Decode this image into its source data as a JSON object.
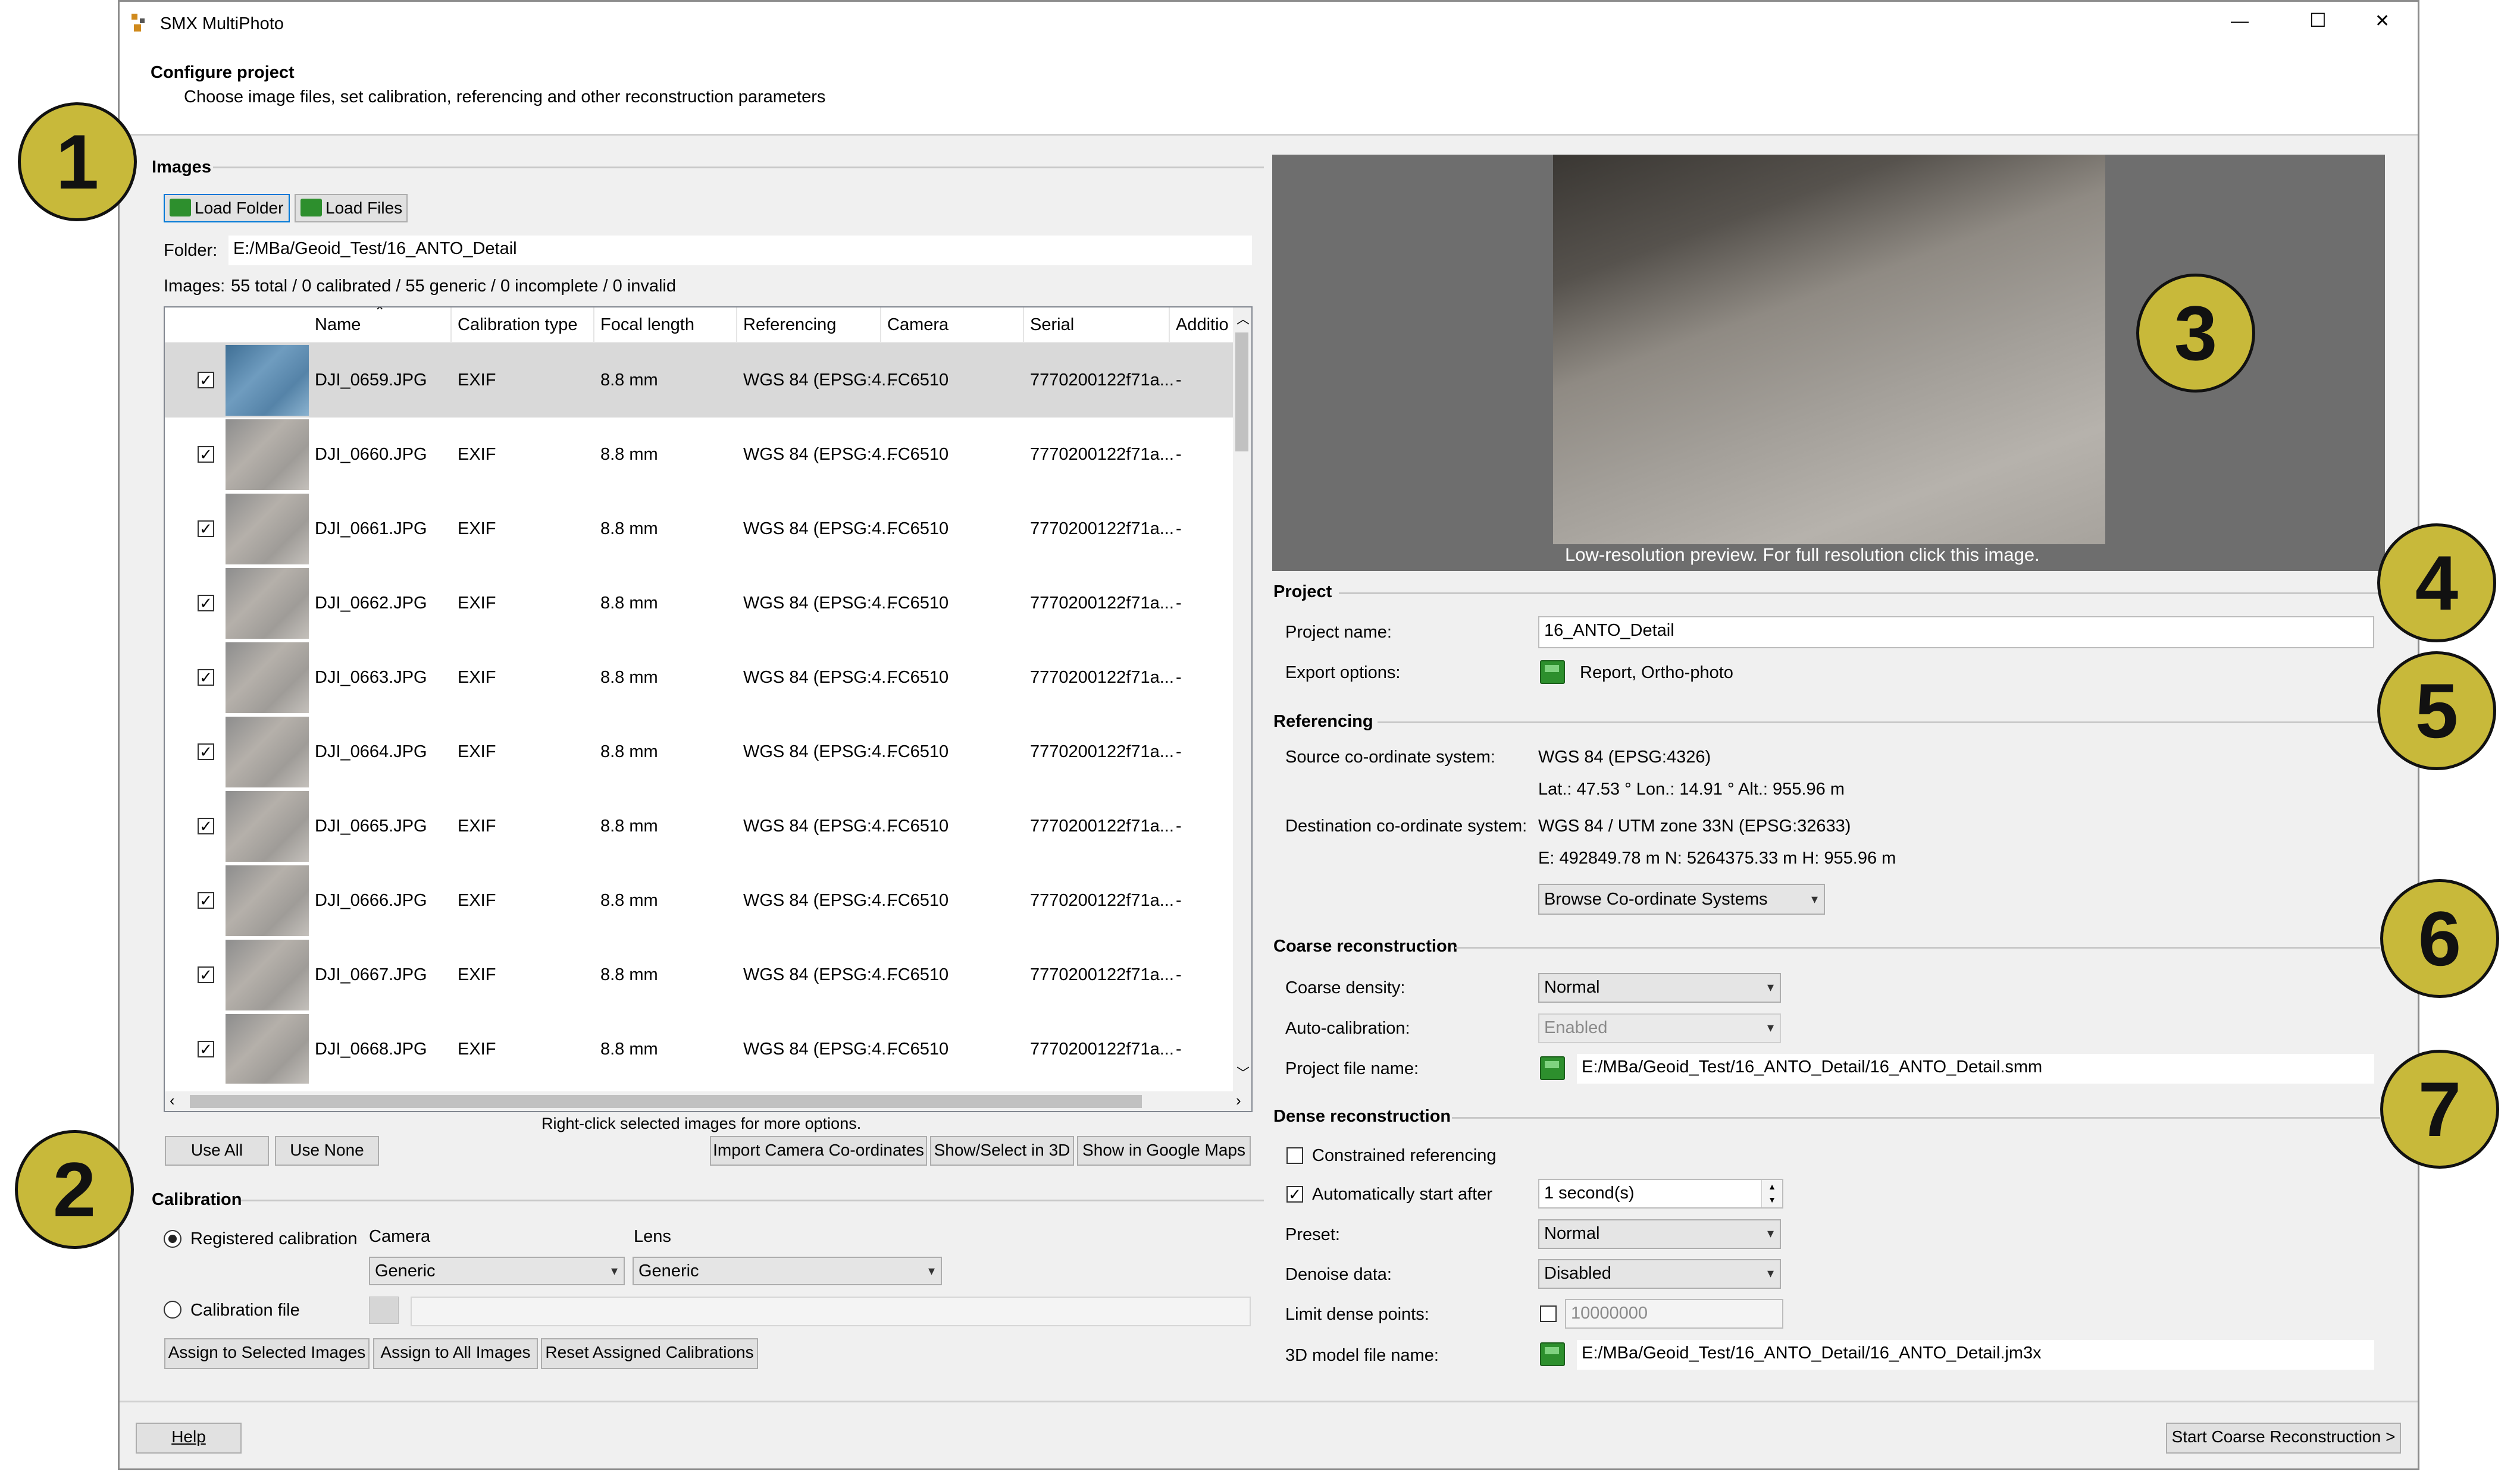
{
  "window": {
    "title": "SMX MultiPhoto",
    "controls": {
      "minimize": "—",
      "maximize": "☐",
      "close": "✕"
    }
  },
  "header": {
    "title": "Configure project",
    "subtitle": "Choose image files, set calibration, referencing and other reconstruction parameters"
  },
  "images": {
    "group_title": "Images",
    "load_folder": "Load Folder",
    "load_files": "Load Files",
    "folder_label": "Folder:",
    "folder_value": "E:/MBa/Geoid_Test/16_ANTO_Detail",
    "summary_label": "Images:",
    "summary_value": "55 total / 0 calibrated / 55 generic / 0 incomplete / 0 invalid",
    "columns": [
      "Name",
      "Calibration type",
      "Focal length",
      "Referencing",
      "Camera",
      "Serial",
      "Additio"
    ],
    "rows": [
      {
        "name": "DJI_0659.JPG",
        "cal": "EXIF",
        "focal": "8.8 mm",
        "ref": "WGS 84 (EPSG:4...",
        "camera": "FC6510",
        "serial": "7770200122f71a...",
        "add": "-",
        "selected": true
      },
      {
        "name": "DJI_0660.JPG",
        "cal": "EXIF",
        "focal": "8.8 mm",
        "ref": "WGS 84 (EPSG:4...",
        "camera": "FC6510",
        "serial": "7770200122f71a...",
        "add": "-"
      },
      {
        "name": "DJI_0661.JPG",
        "cal": "EXIF",
        "focal": "8.8 mm",
        "ref": "WGS 84 (EPSG:4...",
        "camera": "FC6510",
        "serial": "7770200122f71a...",
        "add": "-"
      },
      {
        "name": "DJI_0662.JPG",
        "cal": "EXIF",
        "focal": "8.8 mm",
        "ref": "WGS 84 (EPSG:4...",
        "camera": "FC6510",
        "serial": "7770200122f71a...",
        "add": "-"
      },
      {
        "name": "DJI_0663.JPG",
        "cal": "EXIF",
        "focal": "8.8 mm",
        "ref": "WGS 84 (EPSG:4...",
        "camera": "FC6510",
        "serial": "7770200122f71a...",
        "add": "-"
      },
      {
        "name": "DJI_0664.JPG",
        "cal": "EXIF",
        "focal": "8.8 mm",
        "ref": "WGS 84 (EPSG:4...",
        "camera": "FC6510",
        "serial": "7770200122f71a...",
        "add": "-"
      },
      {
        "name": "DJI_0665.JPG",
        "cal": "EXIF",
        "focal": "8.8 mm",
        "ref": "WGS 84 (EPSG:4...",
        "camera": "FC6510",
        "serial": "7770200122f71a...",
        "add": "-"
      },
      {
        "name": "DJI_0666.JPG",
        "cal": "EXIF",
        "focal": "8.8 mm",
        "ref": "WGS 84 (EPSG:4...",
        "camera": "FC6510",
        "serial": "7770200122f71a...",
        "add": "-"
      },
      {
        "name": "DJI_0667.JPG",
        "cal": "EXIF",
        "focal": "8.8 mm",
        "ref": "WGS 84 (EPSG:4...",
        "camera": "FC6510",
        "serial": "7770200122f71a...",
        "add": "-"
      },
      {
        "name": "DJI_0668.JPG",
        "cal": "EXIF",
        "focal": "8.8 mm",
        "ref": "WGS 84 (EPSG:4...",
        "camera": "FC6510",
        "serial": "7770200122f71a...",
        "add": "-"
      }
    ],
    "hint": "Right-click selected images for more options.",
    "use_all": "Use All",
    "use_none": "Use None",
    "import_coords": "Import Camera Co-ordinates",
    "show_3d": "Show/Select in 3D",
    "show_maps": "Show in Google Maps"
  },
  "calibration": {
    "group_title": "Calibration",
    "registered_label": "Registered calibration",
    "camera_label": "Camera",
    "camera_value": "Generic",
    "lens_label": "Lens",
    "lens_value": "Generic",
    "file_label": "Calibration file",
    "assign_selected": "Assign to Selected Images",
    "assign_all": "Assign to All Images",
    "reset": "Reset Assigned Calibrations"
  },
  "preview": {
    "caption": "Low-resolution preview. For full resolution click this image."
  },
  "project": {
    "group_title": "Project",
    "name_label": "Project name:",
    "name_value": "16_ANTO_Detail",
    "export_label": "Export options:",
    "export_value": "Report, Ortho-photo"
  },
  "referencing": {
    "group_title": "Referencing",
    "source_label": "Source co-ordinate system:",
    "source_value": "WGS 84 (EPSG:4326)",
    "source_coords": "Lat.: 47.53 °   Lon.: 14.91 °   Alt.: 955.96 m",
    "dest_label": "Destination co-ordinate system:",
    "dest_value": "WGS 84 / UTM zone 33N (EPSG:32633)",
    "dest_coords": "E: 492849.78 m   N: 5264375.33 m   H: 955.96 m",
    "browse": "Browse Co-ordinate Systems"
  },
  "coarse": {
    "group_title": "Coarse reconstruction",
    "density_label": "Coarse density:",
    "density_value": "Normal",
    "autocal_label": "Auto-calibration:",
    "autocal_value": "Enabled",
    "file_label": "Project file name:",
    "file_value": "E:/MBa/Geoid_Test/16_ANTO_Detail/16_ANTO_Detail.smm"
  },
  "dense": {
    "group_title": "Dense reconstruction",
    "constrained_label": "Constrained referencing",
    "autostart_label": "Automatically start after",
    "autostart_value": "1 second(s)",
    "preset_label": "Preset:",
    "preset_value": "Normal",
    "denoise_label": "Denoise data:",
    "denoise_value": "Disabled",
    "limit_label": "Limit dense points:",
    "limit_value": "10000000",
    "model_label": "3D model file name:",
    "model_value": "E:/MBa/Geoid_Test/16_ANTO_Detail/16_ANTO_Detail.jm3x"
  },
  "footer": {
    "help": "Help",
    "start": "Start Coarse Reconstruction >"
  },
  "badges": [
    "1",
    "2",
    "3",
    "4",
    "5",
    "6",
    "7"
  ],
  "colors": {
    "badge_fill": "#c8b93a",
    "selection": "#d9d9d9",
    "focus": "#0078d7"
  }
}
